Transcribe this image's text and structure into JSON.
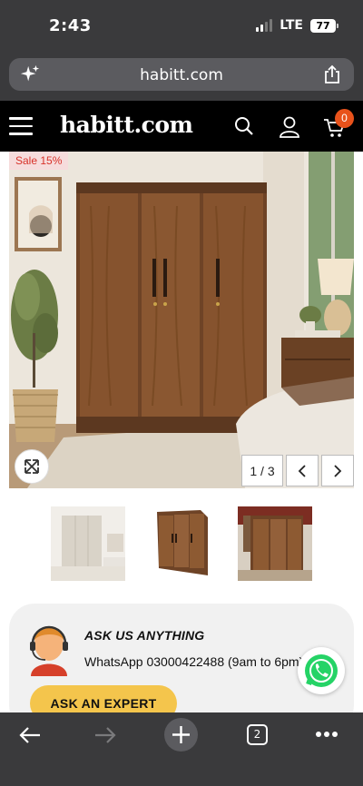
{
  "status_bar": {
    "time": "2:43",
    "network": "LTE",
    "battery": "77"
  },
  "browser": {
    "url": "habitt.com",
    "tabs_count": "2"
  },
  "site_header": {
    "logo": "habitt.com",
    "cart_count": "0"
  },
  "product_gallery": {
    "sale_label": "Sale 15%",
    "current_image": "1",
    "total_images": "3",
    "counter_text": "1 / 3",
    "thumbnails": [
      "thumbnail-1",
      "thumbnail-2",
      "thumbnail-3"
    ]
  },
  "help_card": {
    "title": "ASK US ANYTHING",
    "subtitle": "WhatsApp 03000422488 (9am to 6pm)",
    "button_label": "ASK AN EXPERT"
  },
  "colors": {
    "accent_orange": "#e8521b",
    "sale_red": "#d8332a",
    "cta_yellow": "#f4c54c",
    "whatsapp_green": "#25d366",
    "chrome_dark": "#3a3a3c"
  }
}
